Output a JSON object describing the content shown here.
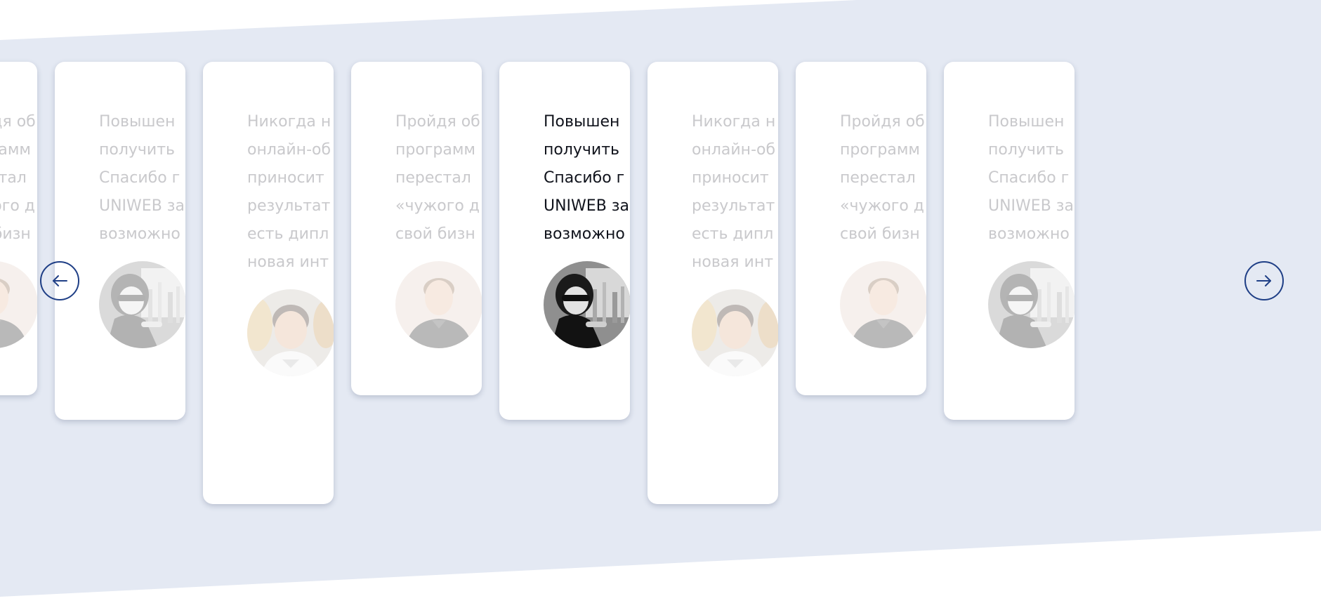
{
  "colors": {
    "band": "#e4e9f3",
    "accent": "#1f3f86",
    "muted_text": "#c9c9cc",
    "active_text": "#10131c"
  },
  "carousel": {
    "prev_icon": "arrow-left-icon",
    "next_icon": "arrow-right-icon",
    "cards": [
      {
        "lines": [
          "Пройдя об",
          "программ",
          "перестал",
          "«чужого д",
          "свой бизн"
        ],
        "avatar": "photo-man-young",
        "active": false
      },
      {
        "lines": [
          "Повышен",
          "получить",
          "Спасибо г",
          "UNIWEB за",
          "возможно"
        ],
        "avatar": "photo-woman-sunglasses",
        "active": false
      },
      {
        "lines": [
          "Никогда н",
          "онлайн-об",
          "приносит",
          "результат",
          "есть дипл",
          "новая инт"
        ],
        "avatar": "photo-man-smiling",
        "active": false
      },
      {
        "lines": [
          "Пройдя об",
          "программ",
          "перестал",
          "«чужого д",
          "свой бизн"
        ],
        "avatar": "photo-man-young",
        "active": false
      },
      {
        "lines": [
          "Повышен",
          "получить",
          "Спасибо г",
          "UNIWEB за",
          "возможно"
        ],
        "avatar": "photo-woman-sunglasses",
        "active": true
      },
      {
        "lines": [
          "Никогда н",
          "онлайн-об",
          "приносит",
          "результат",
          "есть дипл",
          "новая инт"
        ],
        "avatar": "photo-man-smiling",
        "active": false
      },
      {
        "lines": [
          "Пройдя об",
          "программ",
          "перестал",
          "«чужого д",
          "свой бизн"
        ],
        "avatar": "photo-man-young",
        "active": false
      },
      {
        "lines": [
          "Повышен",
          "получить",
          "Спасибо г",
          "UNIWEB за",
          "возможно"
        ],
        "avatar": "photo-woman-sunglasses",
        "active": false
      }
    ]
  }
}
